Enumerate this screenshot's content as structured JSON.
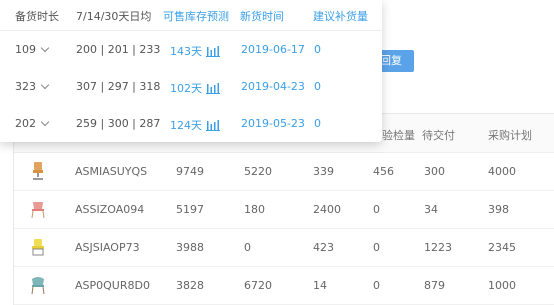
{
  "popover": {
    "headers": {
      "age": "备货时长",
      "avg": "7/14/30天日均",
      "forecast": "可售库存预测",
      "new_time": "新货时间",
      "suggest": "建议补货量"
    },
    "rows": [
      {
        "age": "109",
        "avg": "200 | 201 | 233",
        "forecast": "143天",
        "new_time": "2019-06-17",
        "suggest": "0"
      },
      {
        "age": "323",
        "avg": "307 | 297 | 318",
        "forecast": "102天",
        "new_time": "2019-04-23",
        "suggest": "0"
      },
      {
        "age": "202",
        "avg": "259 | 300 | 287",
        "forecast": "124天",
        "new_time": "2019-05-23",
        "suggest": "0"
      }
    ]
  },
  "restore_button": "回复",
  "table": {
    "headers": {
      "inspect": "验检量",
      "pending": "待交付",
      "plan": "采购计划"
    },
    "rows": [
      {
        "sku": "ASMIASUYQS",
        "c1": "9749",
        "c2": "5220",
        "c3": "339",
        "c4": "456",
        "c5": "300",
        "c6": "4000"
      },
      {
        "sku": "ASSIZOA094",
        "c1": "5197",
        "c2": "180",
        "c3": "2400",
        "c4": "0",
        "c5": "34",
        "c6": "398"
      },
      {
        "sku": "ASJSIAOP73",
        "c1": "3988",
        "c2": "0",
        "c3": "423",
        "c4": "0",
        "c5": "1223",
        "c6": "2345"
      },
      {
        "sku": "ASP0QUR8D0",
        "c1": "3828",
        "c2": "6720",
        "c3": "14",
        "c4": "0",
        "c5": "879",
        "c6": "1000"
      }
    ]
  },
  "colors": {
    "accent": "#3a9fe6",
    "button": "#5ba3e8"
  },
  "icons": {
    "forecast": "bar-chart-icon",
    "dropdown": "chevron-down-icon",
    "product": "chair-thumbnail"
  }
}
